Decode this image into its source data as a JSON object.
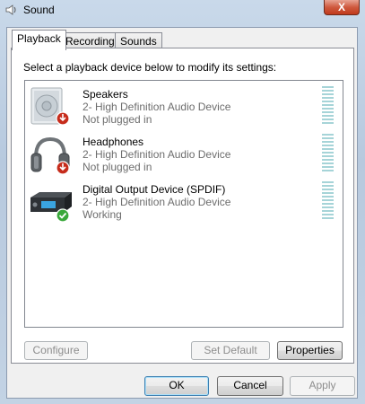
{
  "window": {
    "title": "Sound",
    "close_label": "X"
  },
  "tabs": [
    {
      "label": "Playback",
      "active": true
    },
    {
      "label": "Recording",
      "active": false
    },
    {
      "label": "Sounds",
      "active": false
    }
  ],
  "playback": {
    "instruction": "Select a playback device below to modify its settings:",
    "devices": [
      {
        "name": "Speakers",
        "description": "2- High Definition Audio Device",
        "status": "Not plugged in",
        "icon": "speaker-icon",
        "badge": "unplugged-badge-icon"
      },
      {
        "name": "Headphones",
        "description": "2- High Definition Audio Device",
        "status": "Not plugged in",
        "icon": "headphones-icon",
        "badge": "unplugged-badge-icon"
      },
      {
        "name": "Digital Output Device (SPDIF)",
        "description": "2- High Definition Audio Device",
        "status": "Working",
        "icon": "digital-output-icon",
        "badge": "working-check-icon"
      }
    ],
    "configure_label": "Configure",
    "set_default_label": "Set Default",
    "properties_label": "Properties"
  },
  "footer": {
    "ok_label": "OK",
    "cancel_label": "Cancel",
    "apply_label": "Apply"
  },
  "colors": {
    "accent": "#3c7fb1",
    "meter": "#a6d4d8",
    "close": "#c0391c",
    "status_gray": "#6d6d6d"
  }
}
